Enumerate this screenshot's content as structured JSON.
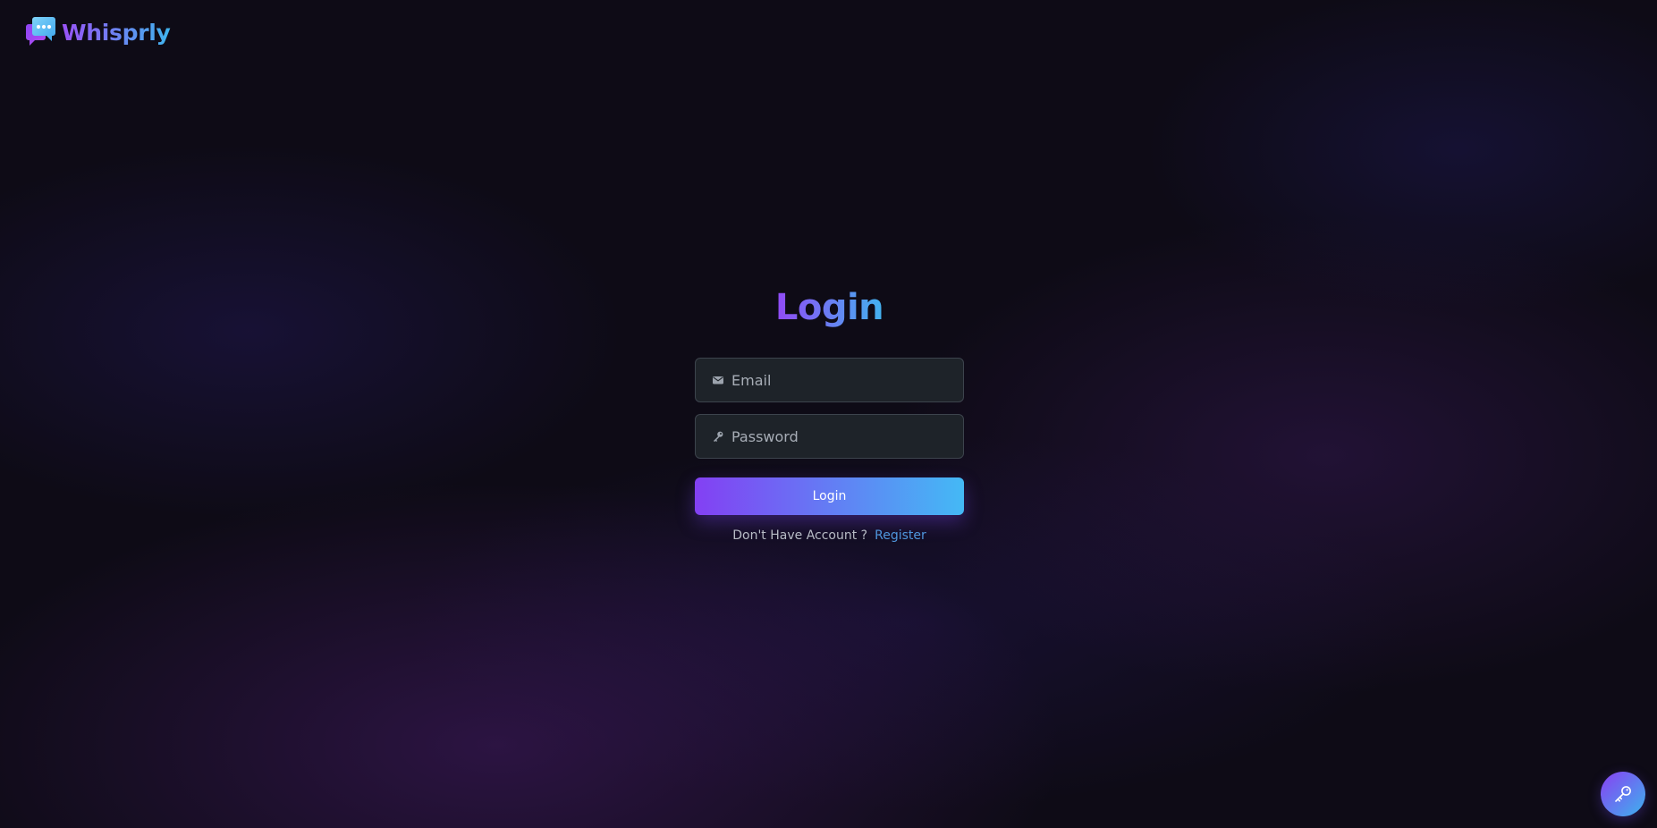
{
  "brand": {
    "name": "Whisprly",
    "logo_icon": "chat-bubbles-icon",
    "gradient_start": "#9a52f7",
    "gradient_end": "#3fb5ee"
  },
  "login": {
    "title": "Login",
    "email": {
      "icon": "envelope-icon",
      "placeholder": "Email",
      "value": ""
    },
    "password": {
      "icon": "key-icon",
      "placeholder": "Password",
      "value": ""
    },
    "submit_label": "Login",
    "register_prompt": "Don't Have Account ?",
    "register_link": "Register"
  },
  "fab": {
    "icon": "key-icon"
  },
  "colors": {
    "background": "#0e0b16",
    "field_background": "#1e2329",
    "field_border": "#3d444d",
    "button_gradient_start": "#8340f3",
    "button_gradient_end": "#44b9f5",
    "link": "#4f96dd"
  }
}
